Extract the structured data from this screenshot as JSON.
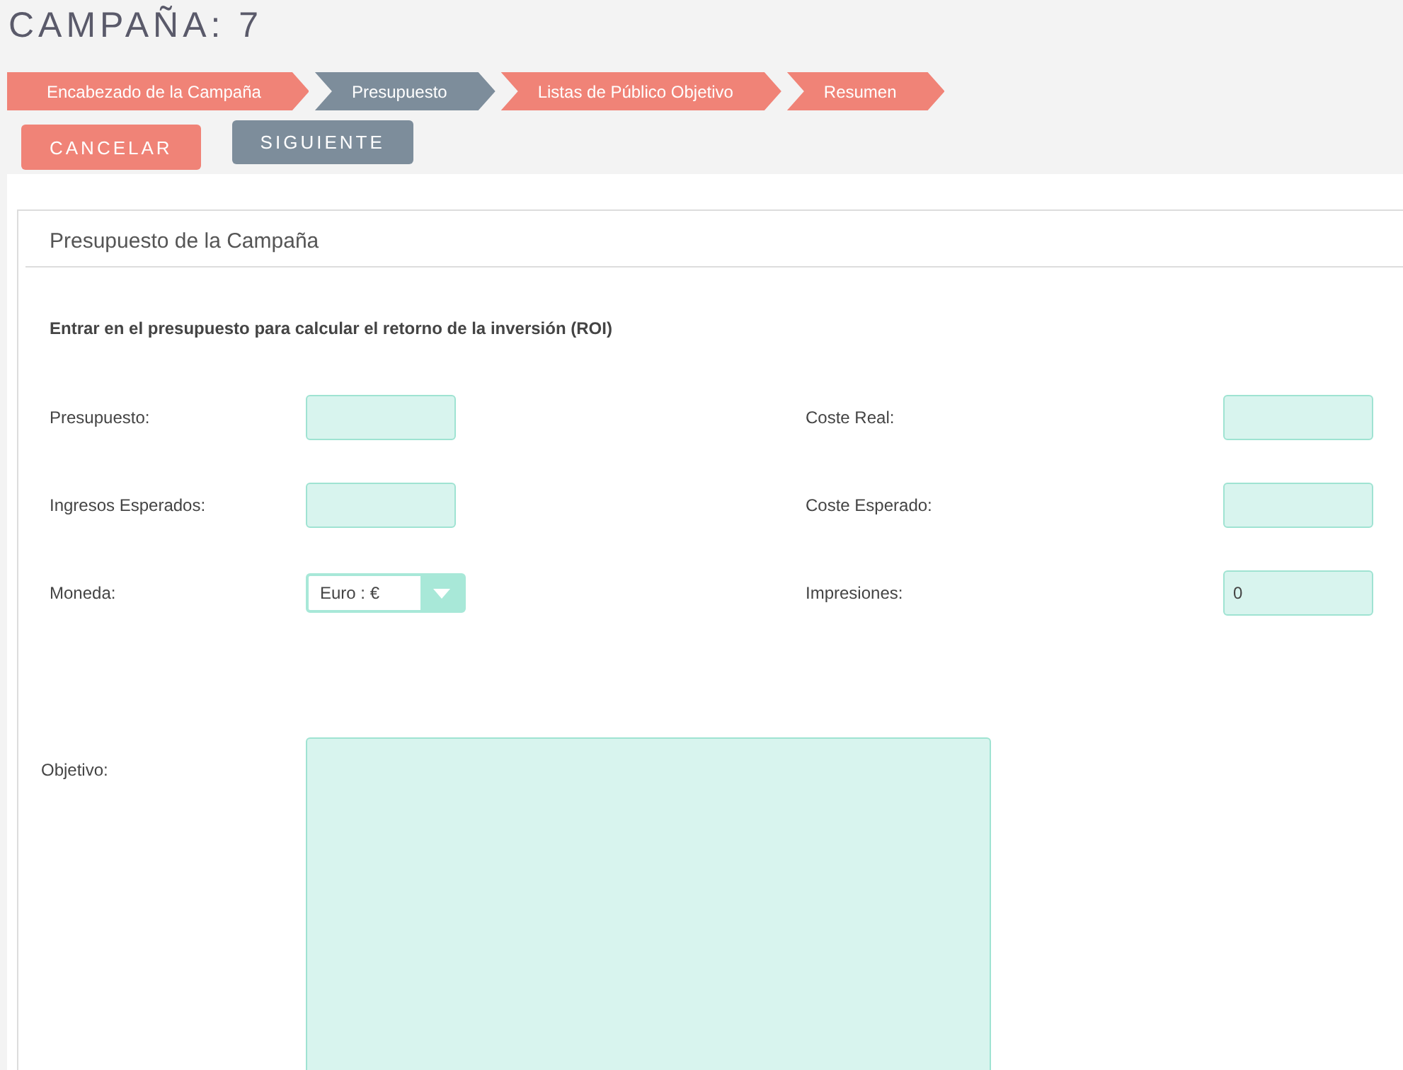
{
  "title": "CAMPAÑA: 7",
  "steps": [
    {
      "label": "Encabezado de la Campaña",
      "selected": false
    },
    {
      "label": "Presupuesto",
      "selected": true
    },
    {
      "label": "Listas de Público Objetivo",
      "selected": false
    },
    {
      "label": "Resumen",
      "selected": false
    }
  ],
  "buttons": [
    {
      "label": "CANCELAR",
      "kind": "cancel"
    },
    {
      "label": "SIGUIENTE",
      "kind": "next"
    }
  ],
  "panel": {
    "title": "Presupuesto de la Campaña",
    "intro": "Entrar en el presupuesto para calcular el retorno de la inversión (ROI)",
    "fields": [
      {
        "label": "Presupuesto:",
        "kind": "text"
      },
      {
        "label": "Coste Real:",
        "kind": "text"
      },
      {
        "label": "Ingresos Esperados:",
        "kind": "text"
      },
      {
        "label": "Coste Esperado:",
        "kind": "text"
      },
      {
        "label": "Moneda:",
        "kind": "select",
        "value": "Euro : €"
      },
      {
        "label": "Impresiones:",
        "kind": "text",
        "value": "0"
      }
    ],
    "objective": {
      "label": "Objetivo:"
    }
  }
}
